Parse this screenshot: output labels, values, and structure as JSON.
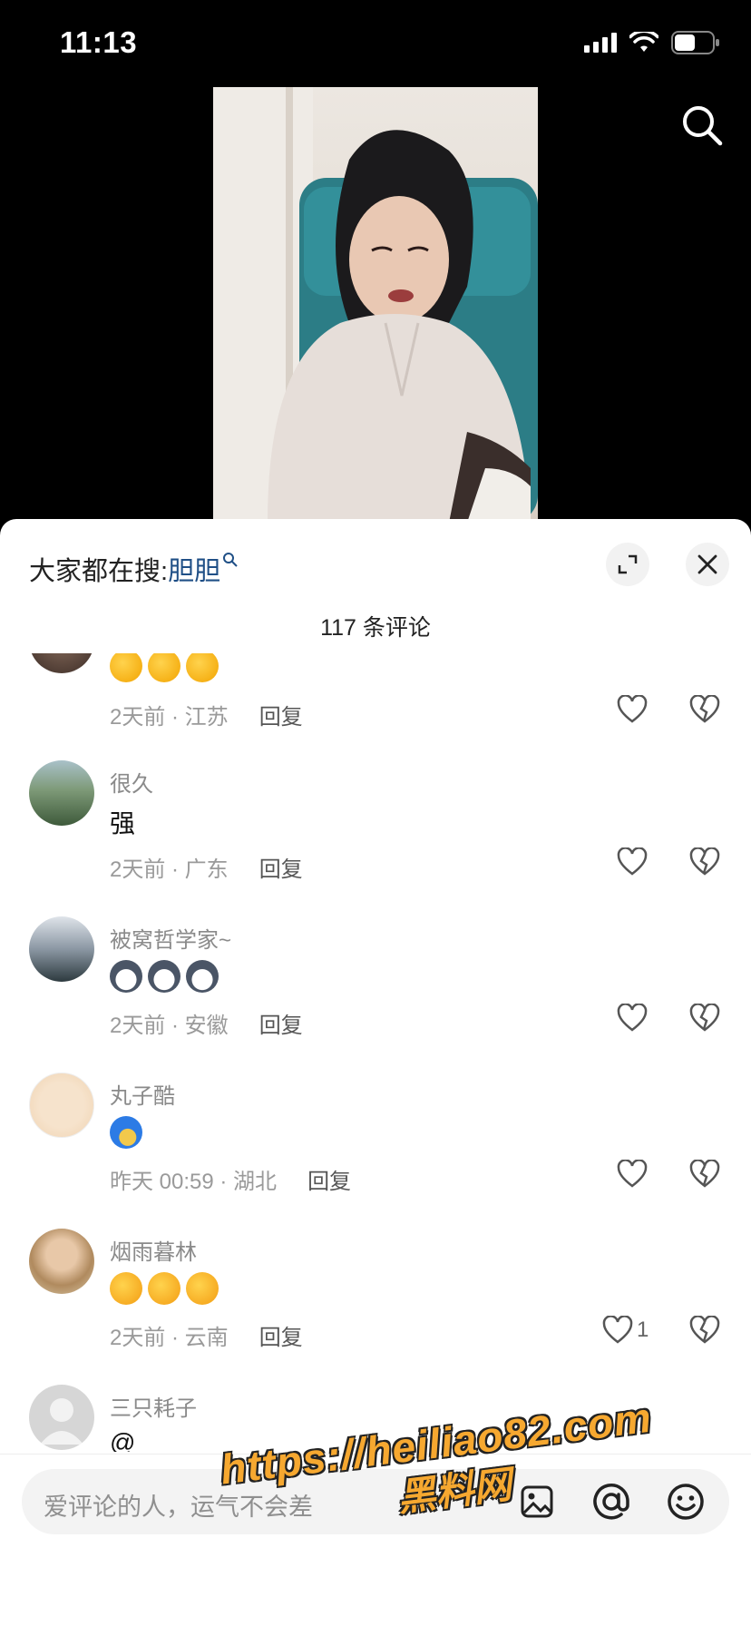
{
  "status": {
    "time": "11:13"
  },
  "trending": {
    "prefix": "大家都在搜:",
    "keyword": "胆胆"
  },
  "comments_header": {
    "count_label": "117 条评论"
  },
  "comments": [
    {
      "name": "",
      "body_emojis": [
        "clap",
        "clap",
        "clap"
      ],
      "time_location": "2天前 · 江苏",
      "reply": "回复",
      "likes": ""
    },
    {
      "name": "很久",
      "body_text": "强",
      "time_location": "2天前 · 广东",
      "reply": "回复",
      "likes": ""
    },
    {
      "name": "被窝哲学家~",
      "body_emojis": [
        "husky",
        "husky",
        "husky"
      ],
      "time_location": "2天前 · 安徽",
      "reply": "回复",
      "likes": ""
    },
    {
      "name": "丸子酷",
      "body_emojis": [
        "blue-hair"
      ],
      "time_location": "昨天 00:59 · 湖北",
      "reply": "回复",
      "likes": ""
    },
    {
      "name": "烟雨暮林",
      "body_emojis": [
        "heart-eyes",
        "heart-eyes",
        "heart-eyes"
      ],
      "time_location": "2天前 · 云南",
      "reply": "回复",
      "likes": "1"
    },
    {
      "name": "三只耗子",
      "body_text": "@",
      "time_location": "",
      "reply": "",
      "likes": ""
    }
  ],
  "input": {
    "placeholder": "爱评论的人，运气不会差"
  },
  "watermark": {
    "line1": "https://heiliao82.com",
    "line2": "黑料网"
  },
  "colors": {
    "accent_link": "#1f4f86",
    "watermark": "#f6a830"
  }
}
